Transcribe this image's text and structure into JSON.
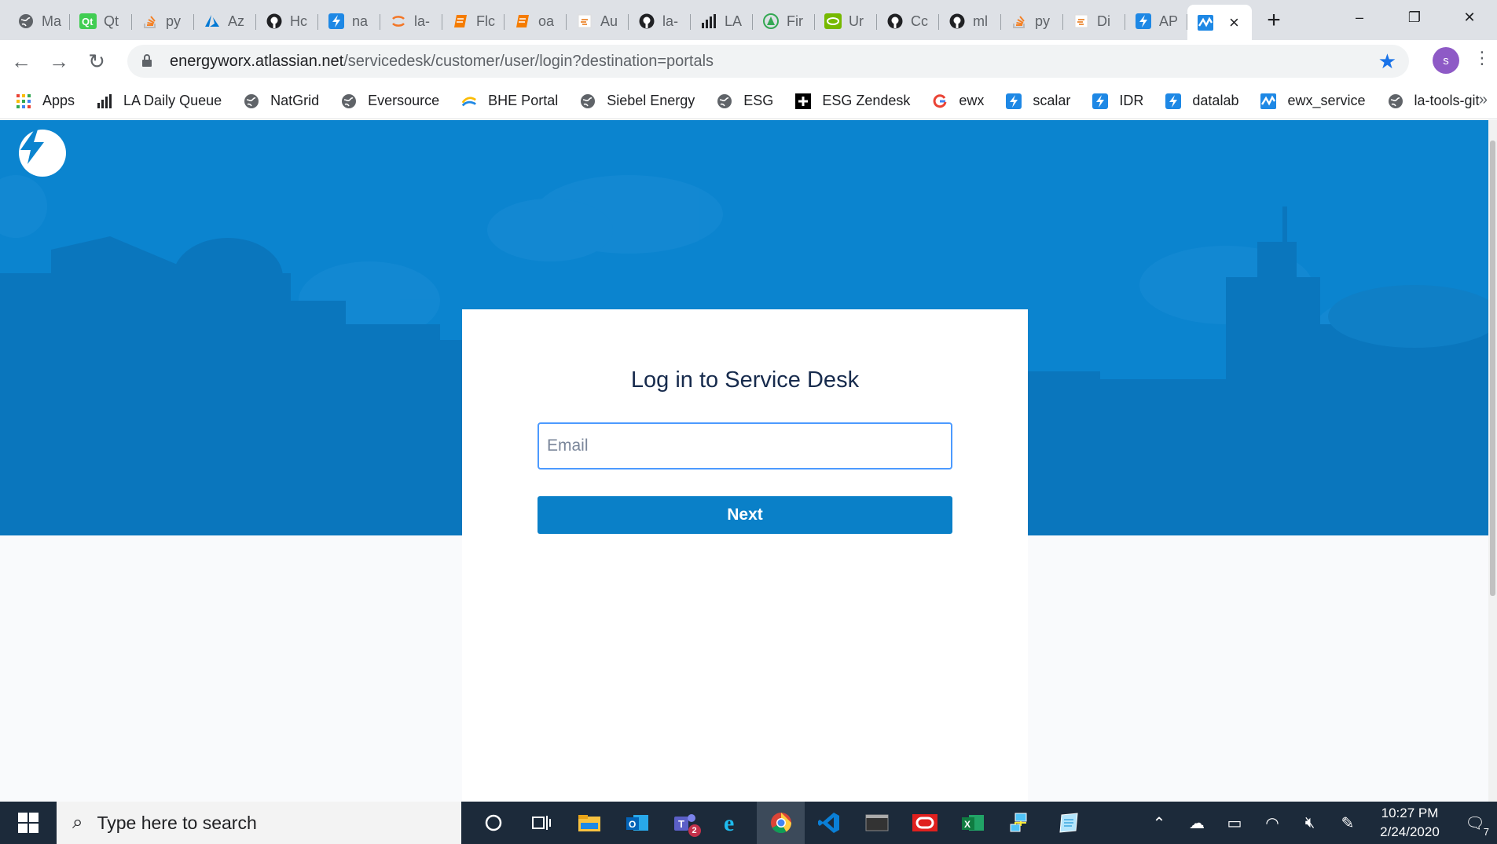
{
  "browser": {
    "tabs": [
      {
        "label": "Ma",
        "icon": "globe-icon",
        "color": "#5f6368"
      },
      {
        "label": "Qt",
        "icon": "qt-icon",
        "color": "#41cd52"
      },
      {
        "label": "py",
        "icon": "stackoverflow-icon",
        "color": "#f48024"
      },
      {
        "label": "Az",
        "icon": "azure-icon",
        "color": "#0078d4"
      },
      {
        "label": "Hc",
        "icon": "github-icon",
        "color": "#202124"
      },
      {
        "label": "na",
        "icon": "bolt-icon",
        "color": "#1e88e5"
      },
      {
        "label": "la-",
        "icon": "jupyter-icon",
        "color": "#f37626"
      },
      {
        "label": "Flc",
        "icon": "book-icon",
        "color": "#f57c00"
      },
      {
        "label": "oa",
        "icon": "book-icon",
        "color": "#f57c00"
      },
      {
        "label": "Au",
        "icon": "doc-icon",
        "color": "#e8710a"
      },
      {
        "label": "la-",
        "icon": "github-icon",
        "color": "#202124"
      },
      {
        "label": "LA",
        "icon": "bars-icon",
        "color": "#202124"
      },
      {
        "label": "Fir",
        "icon": "android-icon",
        "color": "#34a853"
      },
      {
        "label": "Ur",
        "icon": "nvidia-icon",
        "color": "#76b900"
      },
      {
        "label": "Cc",
        "icon": "github-icon",
        "color": "#202124"
      },
      {
        "label": "ml",
        "icon": "github-icon",
        "color": "#202124"
      },
      {
        "label": "py",
        "icon": "stackoverflow-icon",
        "color": "#f48024"
      },
      {
        "label": "Di",
        "icon": "doc-icon",
        "color": "#e8710a"
      },
      {
        "label": "AP",
        "icon": "bolt-icon",
        "color": "#1e88e5"
      }
    ],
    "active_tab": {
      "icon": "pulse-icon",
      "color": "#1e88e5",
      "close_label": "×"
    },
    "new_tab_label": "+",
    "window_controls": {
      "minimize": "–",
      "restore": "❐",
      "close": "✕"
    },
    "url_host": "energyworx.atlassian.net",
    "url_path": "/servicedesk/customer/user/login?destination=portals",
    "profile_initial": "s",
    "bookmarks": [
      {
        "label": "Apps",
        "icon": "apps-grid-icon",
        "color": "#ea4335"
      },
      {
        "label": "LA Daily Queue",
        "icon": "bars-icon",
        "color": "#202124"
      },
      {
        "label": "NatGrid",
        "icon": "globe-icon",
        "color": "#5f6368"
      },
      {
        "label": "Eversource",
        "icon": "globe-icon",
        "color": "#5f6368"
      },
      {
        "label": "BHE Portal",
        "icon": "bhe-icon",
        "color": "#1e88e5"
      },
      {
        "label": "Siebel Energy",
        "icon": "globe-icon",
        "color": "#5f6368"
      },
      {
        "label": "ESG",
        "icon": "globe-icon",
        "color": "#5f6368"
      },
      {
        "label": "ESG Zendesk",
        "icon": "plus-icon",
        "color": "#000000"
      },
      {
        "label": "ewx",
        "icon": "google-icon",
        "color": "#4285f4"
      },
      {
        "label": "scalar",
        "icon": "bolt-icon",
        "color": "#1e88e5"
      },
      {
        "label": "IDR",
        "icon": "bolt-icon",
        "color": "#1e88e5"
      },
      {
        "label": "datalab",
        "icon": "bolt-icon",
        "color": "#1e88e5"
      },
      {
        "label": "ewx_service",
        "icon": "pulse-icon",
        "color": "#1e88e5"
      },
      {
        "label": "la-tools-git",
        "icon": "globe-icon",
        "color": "#5f6368"
      }
    ],
    "bookmarks_more": "»"
  },
  "page": {
    "title": "Log in to Service Desk",
    "email_placeholder": "Email",
    "email_value": "",
    "next_label": "Next",
    "brand_color": "#0b84cf",
    "button_color": "#0a80c8"
  },
  "taskbar": {
    "search_placeholder": "Type here to search",
    "apps": [
      "cortana-icon",
      "task-view-icon",
      "file-explorer-icon",
      "outlook-icon",
      "teams-icon",
      "ie-icon",
      "chrome-icon",
      "vscode-icon",
      "terminal-icon",
      "oracle-icon",
      "excel-icon",
      "network-icon",
      "notepad-icon"
    ],
    "teams_badge": "2",
    "time": "10:27 PM",
    "date": "2/24/2020",
    "notification_count": "7"
  }
}
